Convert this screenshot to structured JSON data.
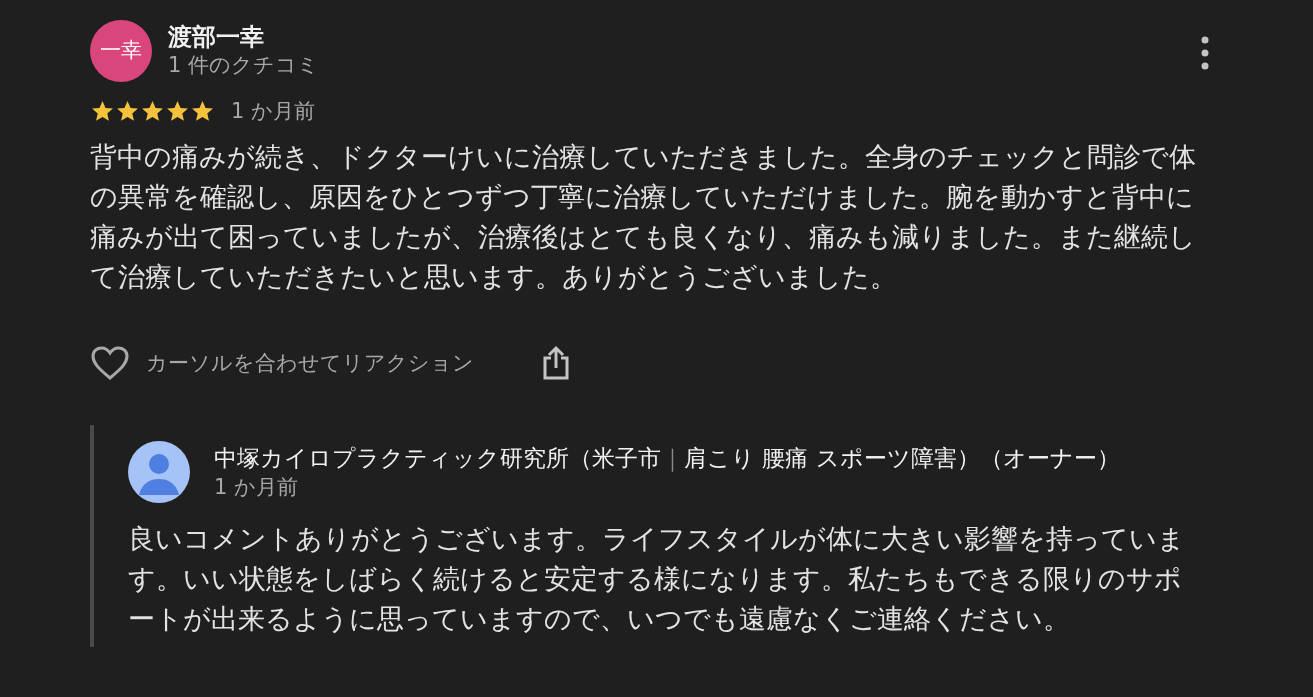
{
  "review": {
    "avatar_initials": "一幸",
    "author": "渡部一幸",
    "review_count": "1 件のクチコミ",
    "stars": 5,
    "time": "1 か月前",
    "text": "背中の痛みが続き、ドクターけいに治療していただきました。全身のチェックと問診で体の異常を確認し、原因をひとつずつ丁寧に治療していただけました。腕を動かすと背中に痛みが出て困っていましたが、治療後はとても良くなり、痛みも減りました。また継続して治療していただきたいと思います。ありがとうございました。",
    "reaction_label": "カーソルを合わせてリアクション"
  },
  "owner_reply": {
    "author": "中塚カイロプラクティック研究所（米子市",
    "separator": "｜",
    "author_rest": "肩こり 腰痛 スポーツ障害）（オーナー）",
    "time": "1 か月前",
    "text": "良いコメントありがとうございます。ライフスタイルが体に大きい影響を持っています。いい状態をしばらく続けると安定する様になります。私たちもできる限りのサポートが出来るように思っていますので、いつでも遠慮なくご連絡ください。"
  }
}
